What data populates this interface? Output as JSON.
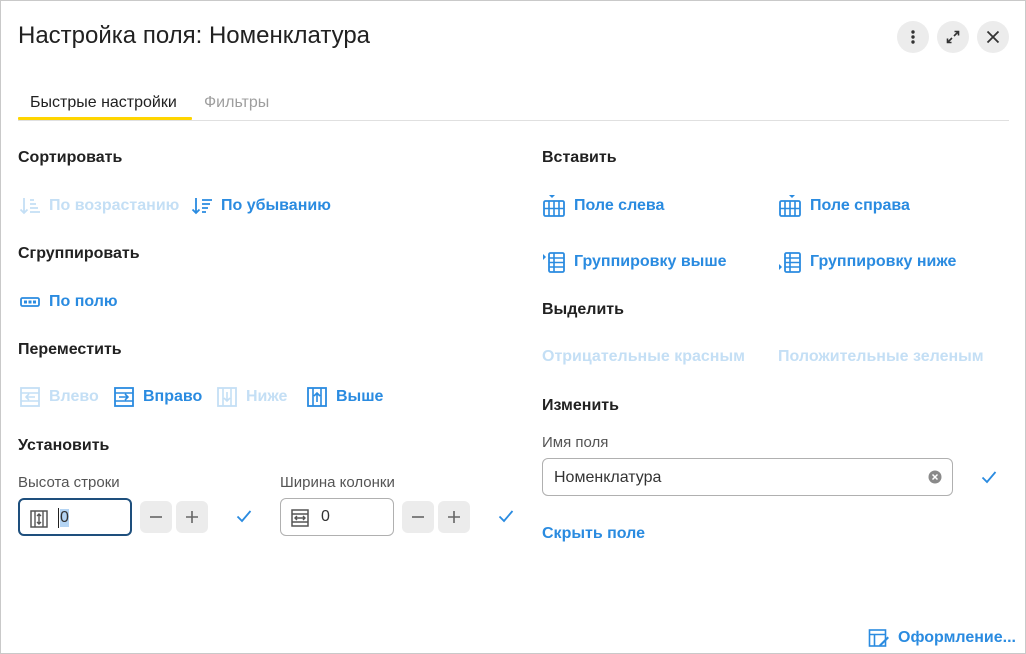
{
  "dialog": {
    "title": "Настройка поля: Номенклатура",
    "header_buttons": [
      "more-vert-icon",
      "expand-icon",
      "close-icon"
    ]
  },
  "tabs": [
    {
      "label": "Быстрые настройки",
      "active": true
    },
    {
      "label": "Фильтры",
      "active": false
    }
  ],
  "sort": {
    "heading": "Сортировать",
    "asc": {
      "label": "По возрастанию",
      "enabled": false
    },
    "desc": {
      "label": "По убыванию",
      "enabled": true
    }
  },
  "group": {
    "heading": "Сгруппировать",
    "by_field": {
      "label": "По полю",
      "enabled": true
    }
  },
  "move": {
    "heading": "Переместить",
    "left": {
      "label": "Влево",
      "enabled": false
    },
    "right": {
      "label": "Вправо",
      "enabled": true
    },
    "down": {
      "label": "Ниже",
      "enabled": false
    },
    "up": {
      "label": "Выше",
      "enabled": true
    }
  },
  "set": {
    "heading": "Установить",
    "row_height": {
      "label": "Высота строки",
      "value": "0"
    },
    "column_width": {
      "label": "Ширина колонки",
      "value": "0"
    }
  },
  "insert": {
    "heading": "Вставить",
    "field_left": "Поле слева",
    "field_right": "Поле справа",
    "group_above": "Группировку выше",
    "group_below": "Группировку ниже"
  },
  "highlight": {
    "heading": "Выделить",
    "negative_red": {
      "label": "Отрицательные красным",
      "enabled": false
    },
    "positive_green": {
      "label": "Положительные зеленым",
      "enabled": false
    }
  },
  "change": {
    "heading": "Изменить",
    "field_name_label": "Имя поля",
    "field_name_value": "Номенклатура",
    "hide_field": "Скрыть поле"
  },
  "footer": {
    "format_link": "Оформление..."
  },
  "colors": {
    "accent": "#2a8be0",
    "disabled": "#c4dff5",
    "tab_underline": "#ffd500",
    "focus_border": "#1e4f7d"
  }
}
